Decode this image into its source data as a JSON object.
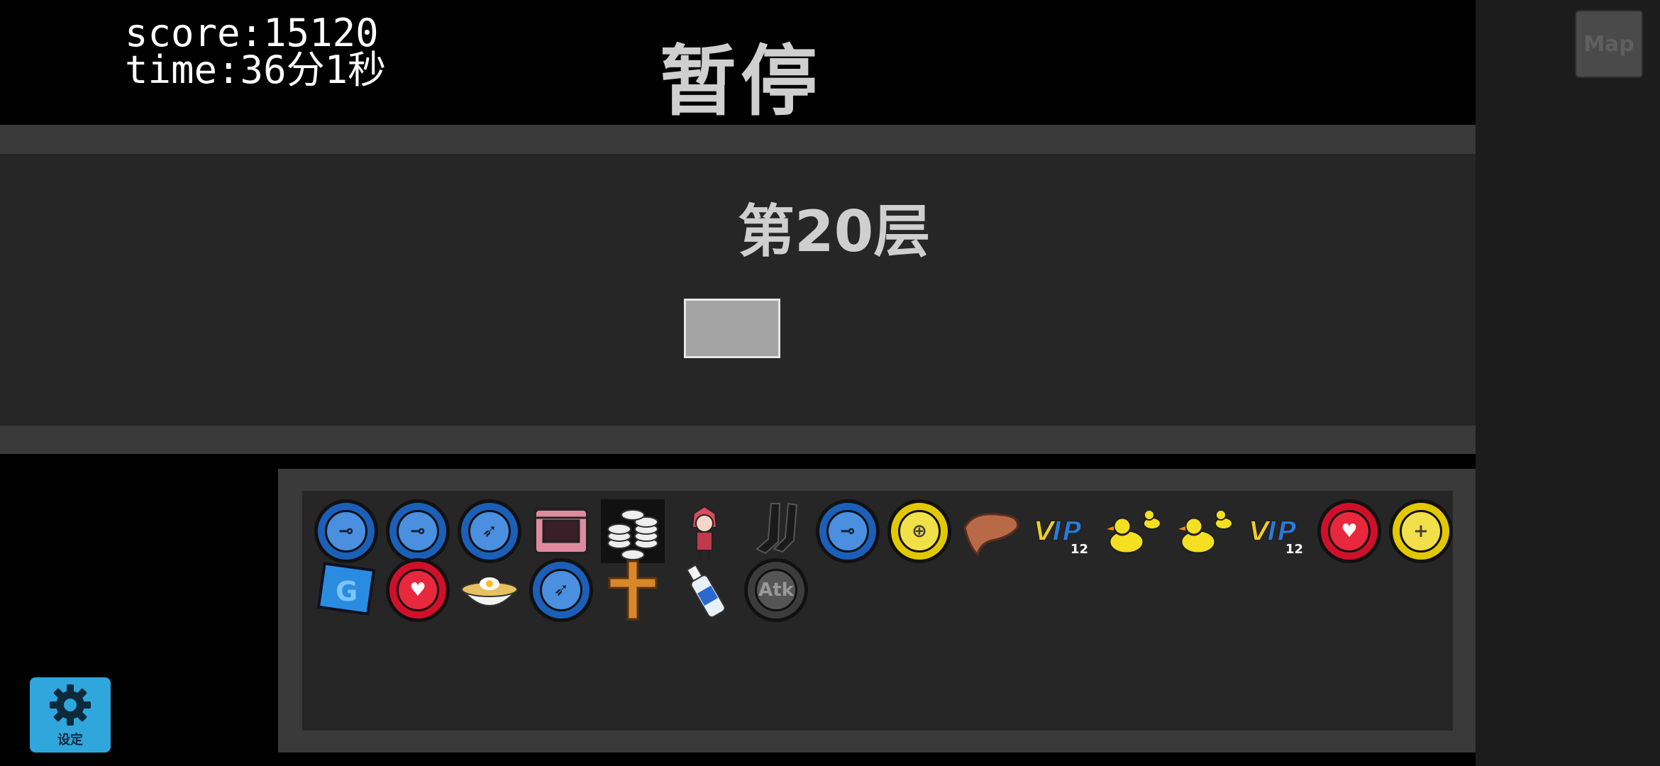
{
  "hud": {
    "score_text": "score:15120",
    "time_text": "time:36分1秒"
  },
  "pause": {
    "title": "暂停"
  },
  "map": {
    "label": "Map"
  },
  "floor": {
    "label": "第20层"
  },
  "settings": {
    "label": "设定",
    "icon": "gear-icon"
  },
  "inventory": {
    "items": [
      {
        "name": "blue-sword-coin-icon",
        "kind": "coin",
        "color": "blue",
        "glyph": "⊸"
      },
      {
        "name": "blue-sword-coin-icon",
        "kind": "coin",
        "color": "blue",
        "glyph": "⊸"
      },
      {
        "name": "blue-bow-coin-icon",
        "kind": "coin",
        "color": "blue",
        "glyph": "➶"
      },
      {
        "name": "pink-treasure-chest-icon",
        "kind": "chest"
      },
      {
        "name": "coin-stacks-icon",
        "kind": "stacks"
      },
      {
        "name": "red-hood-girl-icon",
        "kind": "girl"
      },
      {
        "name": "black-stockings-icon",
        "kind": "socks"
      },
      {
        "name": "blue-sword-coin-icon",
        "kind": "coin",
        "color": "blue",
        "glyph": "⊸"
      },
      {
        "name": "yellow-shield-coin-icon",
        "kind": "coin",
        "color": "yellow",
        "glyph": "⊕"
      },
      {
        "name": "liver-icon",
        "kind": "liver"
      },
      {
        "name": "vip12-badge-icon",
        "kind": "vip",
        "text": "VIP",
        "sub": "12"
      },
      {
        "name": "yellow-ducks-icon",
        "kind": "ducks"
      },
      {
        "name": "yellow-ducks-icon",
        "kind": "ducks"
      },
      {
        "name": "vip12-badge-icon",
        "kind": "vip",
        "text": "VIP",
        "sub": "12"
      },
      {
        "name": "red-heart-coin-icon",
        "kind": "coin",
        "color": "red",
        "glyph": "♥"
      },
      {
        "name": "yellow-plus-sword-coin-icon",
        "kind": "coin",
        "color": "yellow",
        "glyph": "+"
      },
      {
        "name": "blue-g-card-icon",
        "kind": "gcard",
        "text": "G"
      },
      {
        "name": "red-heart-coin-icon",
        "kind": "coin",
        "color": "red",
        "glyph": "♥"
      },
      {
        "name": "noodle-bowl-icon",
        "kind": "bowl"
      },
      {
        "name": "blue-bow-coin-icon",
        "kind": "coin",
        "color": "blue",
        "glyph": "➶"
      },
      {
        "name": "golden-cross-icon",
        "kind": "cross"
      },
      {
        "name": "water-bottle-icon",
        "kind": "bottle"
      },
      {
        "name": "grey-atk-coin-icon",
        "kind": "coin",
        "color": "grey",
        "glyph": "Atk"
      }
    ]
  }
}
